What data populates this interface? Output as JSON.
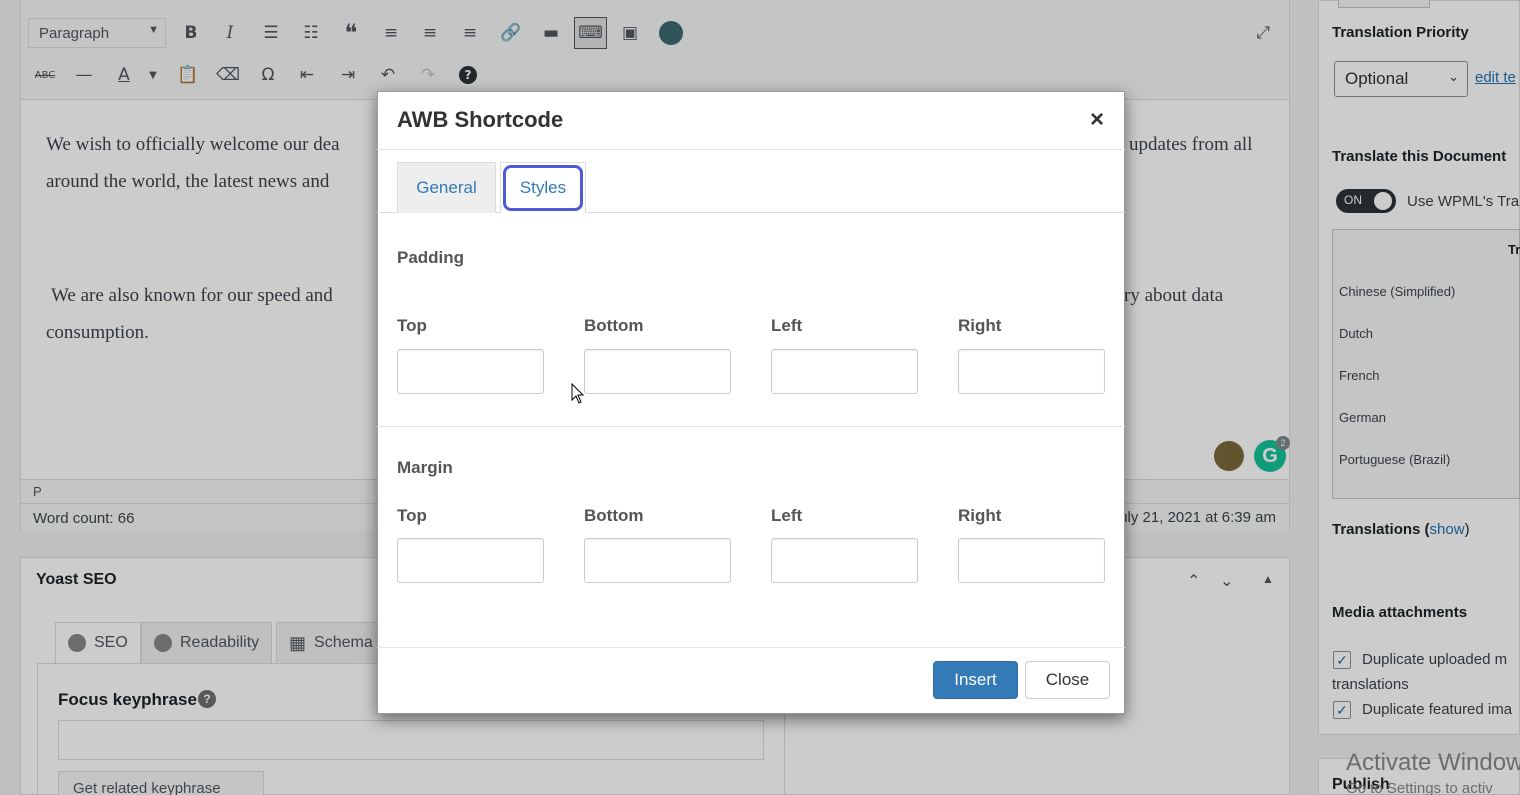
{
  "editor": {
    "format_select": "Paragraph",
    "paragraph1": "We wish to officially welcome our dea                                                                              updates from all around the world, the latest news and",
    "paragraph1_a": "We wish to officially welcome our dea",
    "paragraph1_b": "updates from all",
    "paragraph1_c": "around the world, the latest news and",
    "paragraph2_a": "We are also known for our speed and",
    "paragraph2_b": "ry about data",
    "paragraph2_c": "consumption.",
    "path": "P",
    "word_count": "Word count: 66",
    "last_edited": "uly 21, 2021 at 6:39 am",
    "grammarly_badge": "2"
  },
  "yoast": {
    "title": "Yoast SEO",
    "tabs": [
      {
        "label": "SEO"
      },
      {
        "label": "Readability"
      },
      {
        "label": "Schema"
      }
    ],
    "focus_label": "Focus keyphrase",
    "help": "?",
    "related_button": "Get related keyphrase"
  },
  "sidebar": {
    "translation_priority_label": "Translation Priority",
    "priority_value": "Optional",
    "edit_link": "edit te",
    "translate_doc_label": "Translate this Document",
    "toggle_label": "ON",
    "toggle_text": "Use WPML's Tra",
    "table_header": "Tr",
    "languages": [
      "Chinese (Simplified)",
      "Dutch",
      "French",
      "German",
      "Portuguese (Brazil)"
    ],
    "translations_label": "Translations (",
    "translations_link": "show",
    "translations_end": ")",
    "media_label": "Media attachments",
    "cb1_text": "Duplicate uploaded m",
    "cb1_text2": "translations",
    "cb2_text": "Duplicate featured ima",
    "publish": "Publish",
    "activate_title": "Activate Window",
    "activate_sub": "Go to Settings to activ"
  },
  "modal": {
    "title": "AWB Shortcode",
    "close": "×",
    "tabs": [
      {
        "label": "General"
      },
      {
        "label": "Styles"
      }
    ],
    "padding_label": "Padding",
    "margin_label": "Margin",
    "fields": [
      "Top",
      "Bottom",
      "Left",
      "Right"
    ],
    "insert": "Insert",
    "close_button": "Close"
  },
  "colors": {
    "accent": "#337ab7",
    "focus_ring": "#4f5bd5"
  }
}
